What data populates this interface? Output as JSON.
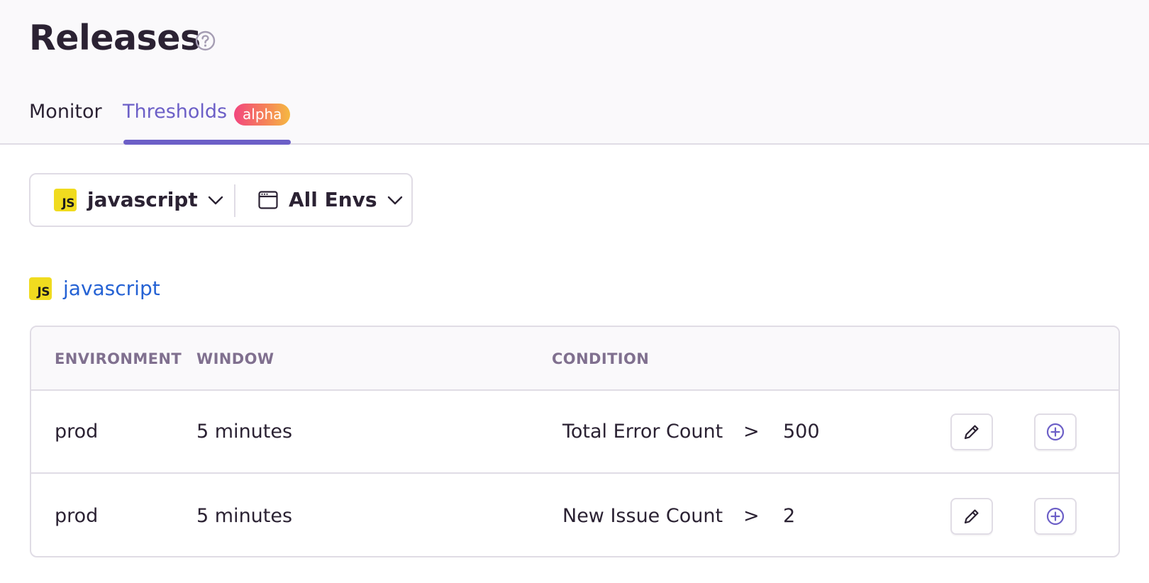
{
  "page": {
    "title": "Releases"
  },
  "tabs": {
    "monitor": "Monitor",
    "thresholds": "Thresholds",
    "badge": "alpha"
  },
  "filters": {
    "project": "javascript",
    "project_icon_text": "JS",
    "environment": "All Envs"
  },
  "section": {
    "project_name": "javascript",
    "project_icon_text": "JS"
  },
  "table": {
    "headers": {
      "environment": "ENVIRONMENT",
      "window": "WINDOW",
      "condition": "CONDITION"
    },
    "rows": [
      {
        "environment": "prod",
        "window": "5 minutes",
        "metric": "Total Error Count",
        "operator": ">",
        "value": "500"
      },
      {
        "environment": "prod",
        "window": "5 minutes",
        "metric": "New Issue Count",
        "operator": ">",
        "value": "2"
      }
    ]
  },
  "icons": {
    "help": "question-circle-icon",
    "chevron": "chevron-down-icon",
    "calendar": "calendar-icon",
    "edit": "pencil-icon",
    "add": "plus-circle-icon",
    "project": "javascript-logo"
  },
  "colors": {
    "accent": "#6c5fc7",
    "link": "#2562d4",
    "js_yellow": "#f0db1f",
    "badge_gradient_start": "#f2467e",
    "badge_gradient_end": "#f5b941"
  }
}
